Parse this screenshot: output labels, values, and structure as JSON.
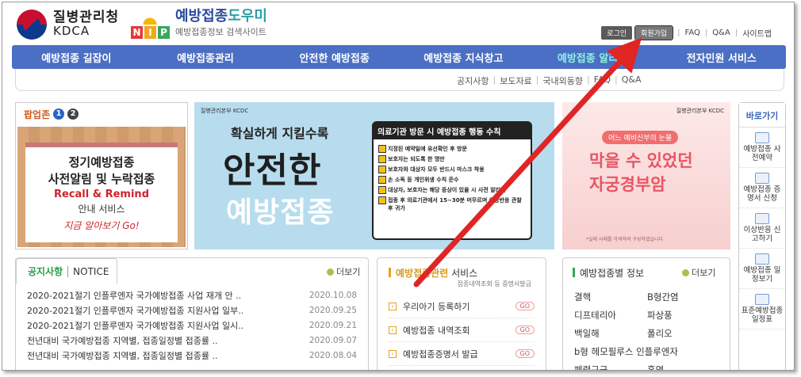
{
  "header": {
    "agency_ko": "질병관리청",
    "agency_en": "KDCA",
    "nip_letters": [
      "N",
      "I",
      "P"
    ],
    "brand_main": "예방접종",
    "brand_hi": "도우미",
    "brand_sub": "예방접종정보 검색사이트",
    "login": "로그인",
    "join": "회원가입",
    "faq": "FAQ",
    "qa": "Q&A",
    "sitemap": "사이트맵"
  },
  "gnb": [
    "예방접종 길잡이",
    "예방접종관리",
    "안전한 예방접종",
    "예방접종 지식창고",
    "예방접종 알리미",
    "전자민원 서비스"
  ],
  "subnav": [
    "공지사항",
    "보도자료",
    "국내외동향",
    "FAQ",
    "Q&A"
  ],
  "popup": {
    "title": "팝업존",
    "nums": [
      "1",
      "2"
    ],
    "l1": "정기예방접종",
    "l2": "사전알림 및 누락접종",
    "l3": "Recall & Remind",
    "l4": "안내 서비스",
    "l5": "지금 알아보기 Go!"
  },
  "banner1": {
    "agency": "질병관리본부 KCDC",
    "t1": "확실하게 지킬수록",
    "t2": "안전한",
    "t3": "예방접종",
    "card_title": "의료기관 방문 시 예방접종 행동 수칙",
    "items": [
      "지정된 예약일에 유선확인 후 방문",
      "보호자는 되도록 한 명만",
      "보호자와 대상자 모두 반드시 마스크 착용",
      "손 소독 등 개인위생 수칙 준수",
      "대상자, 보호자는 해당 증상이 있을 시 사전 알리기",
      "접종 후 의료기관에서 15~30분 머무르며 이상반응 관찰 후 귀가"
    ]
  },
  "banner2": {
    "agency": "질병관리본부 KCDC",
    "pill": "어느 예비신부의 눈물",
    "t1": "막을 수 있었던",
    "t2": "자궁경부암",
    "foot": "*실제 사례를 각색하여 구성하였습니다."
  },
  "quick": {
    "title": "바로가기",
    "items": [
      "예방접종 사전예약",
      "예방접종 증명서 신청",
      "이상반응 신고하기",
      "예방접종 일정보기",
      "표준예방접종 일정표"
    ]
  },
  "notice": {
    "tab1": "공지사항",
    "tab2": "NOTICE",
    "more": "더보기",
    "items": [
      {
        "title": "2020-2021절기 인플루엔자 국가예방접종 사업 재개 안 ..",
        "date": "2020.10.08"
      },
      {
        "title": "2020-2021절기 인플루엔자 국가예방접종 지원사업 일부..",
        "date": "2020.09.25"
      },
      {
        "title": "2020-2021절기 인플루엔자 국가예방접종 지원사업 일시..",
        "date": "2020.09.21"
      },
      {
        "title": "전년대비 국가예방접종 지역별, 접종일정별 접종률 ..",
        "date": "2020.09.07"
      },
      {
        "title": "전년대비 국가예방접종 지역별, 접종일정별 접종률 ..",
        "date": "2020.08.04"
      }
    ]
  },
  "service": {
    "title_bold": "예방접종관련",
    "title_rest": " 서비스",
    "sub": "접종내역조회 등 증명서발급",
    "items": [
      "우리아기 등록하기",
      "예방접종 내역조회",
      "예방접종증명서 발급"
    ],
    "go": "GO"
  },
  "vacc": {
    "title": "예방접종별 정보",
    "more": "더보기",
    "items": [
      "결핵",
      "B형간염",
      "디프테리아",
      "파상풍",
      "백일해",
      "폴리오",
      "b형 헤모필루스 인플루엔자",
      "폐렴구균",
      "홍역"
    ]
  },
  "colors": {
    "gnb": "#4b6fc4",
    "arrow": "#e02525"
  }
}
